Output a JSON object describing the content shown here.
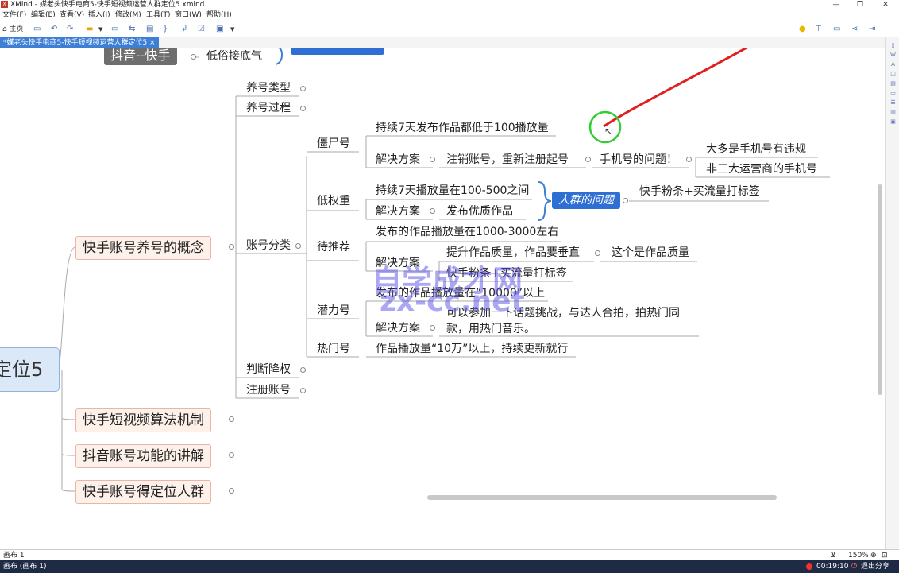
{
  "window": {
    "app_icon": "XMind-app-icon",
    "title": "XMind - 媒老头快手电商5-快手短视频运营人群定位5.xmind",
    "controls": [
      "—",
      "❐",
      "✕"
    ]
  },
  "menu": [
    "文件(F)",
    "编辑(E)",
    "查看(V)",
    "插入(I)",
    "修改(M)",
    "工具(T)",
    "窗口(W)",
    "帮助(H)"
  ],
  "toolbar": {
    "home_label": "主页",
    "icons": [
      "home-icon",
      "save-icon",
      "undo-icon",
      "redo-icon",
      "open-folder-icon",
      "dropdown-icon",
      "topic-icon",
      "relationship-icon",
      "boundary-icon",
      "summary-icon",
      "note-icon",
      "task-icon",
      "image-icon",
      "dropdown-icon"
    ],
    "right_icons": [
      "idea-icon",
      "outline-icon",
      "presentation-icon",
      "share-icon",
      "export-icon"
    ]
  },
  "tab": {
    "label": "*媒老头快手电商5-快手短视频运营人群定位5 ×"
  },
  "right_panel_icons": [
    "ruler-icon",
    "w-icon",
    "ai-icon",
    "format-icon",
    "notes-icon",
    "outline-icon",
    "list-icon",
    "doc-icon",
    "image-icon"
  ],
  "mindmap": {
    "root_partial": "定位5",
    "top_gray": "抖音--快手",
    "top_gray_child": "低俗接底气",
    "level1": [
      "快手账号养号的概念",
      "快手短视频算法机制",
      "抖音账号功能的讲解",
      "快手账号得定位人群"
    ],
    "level2": [
      "养号类型",
      "养号过程",
      "账号分类",
      "判断降权",
      "注册账号"
    ],
    "categories": [
      "僵尸号",
      "低权重",
      "待推荐",
      "潜力号",
      "热门号"
    ],
    "zombie": {
      "desc": "持续7天发布作品都低于100播放量",
      "solution_label": "解决方案",
      "solution": "注销账号，重新注册起号",
      "problem": "手机号的问题！",
      "problems": [
        "大多是手机号有违规",
        "非三大运营商的手机号"
      ]
    },
    "low": {
      "desc": "持续7天播放量在100-500之间",
      "solution_label": "解决方案",
      "solution": "发布优质作品",
      "tag": "人群的问题",
      "tag_child": "快手粉条+买流量打标签"
    },
    "pending": {
      "desc": "发布的作品播放量在1000-3000左右",
      "solution_label": "解决方案",
      "solutions": [
        "提升作品质量，作品要垂直",
        "快手粉条+买流量打标签"
      ],
      "quality": "这个是作品质量"
    },
    "potential": {
      "desc": "发布的作品播放量在“10000”以上",
      "solution_label": "解决方案",
      "solution_line1": "可以参加一下话题挑战，与达人合拍，拍热门同",
      "solution_line2": "款，用热门音乐。"
    },
    "hot": {
      "desc": "作品播放量“10万”以上，持续更新就行"
    }
  },
  "watermark": {
    "line1": "自学成才网",
    "line2": "zx-cc.net"
  },
  "sheet": {
    "tab": "画布 1",
    "status": "画布 (画布 1)",
    "zoom": "150%"
  },
  "recording": {
    "time": "00:19:10",
    "exit": "退出分享"
  },
  "colors": {
    "accent": "#3e7fd6",
    "level1_fill": "#fdf1ea",
    "level1_border": "#e9b6a6",
    "root_fill": "#dbe8f8",
    "tag_blue": "#2f6fd3",
    "annotation_red": "#e02020",
    "cursor_ring": "#33cc33"
  }
}
